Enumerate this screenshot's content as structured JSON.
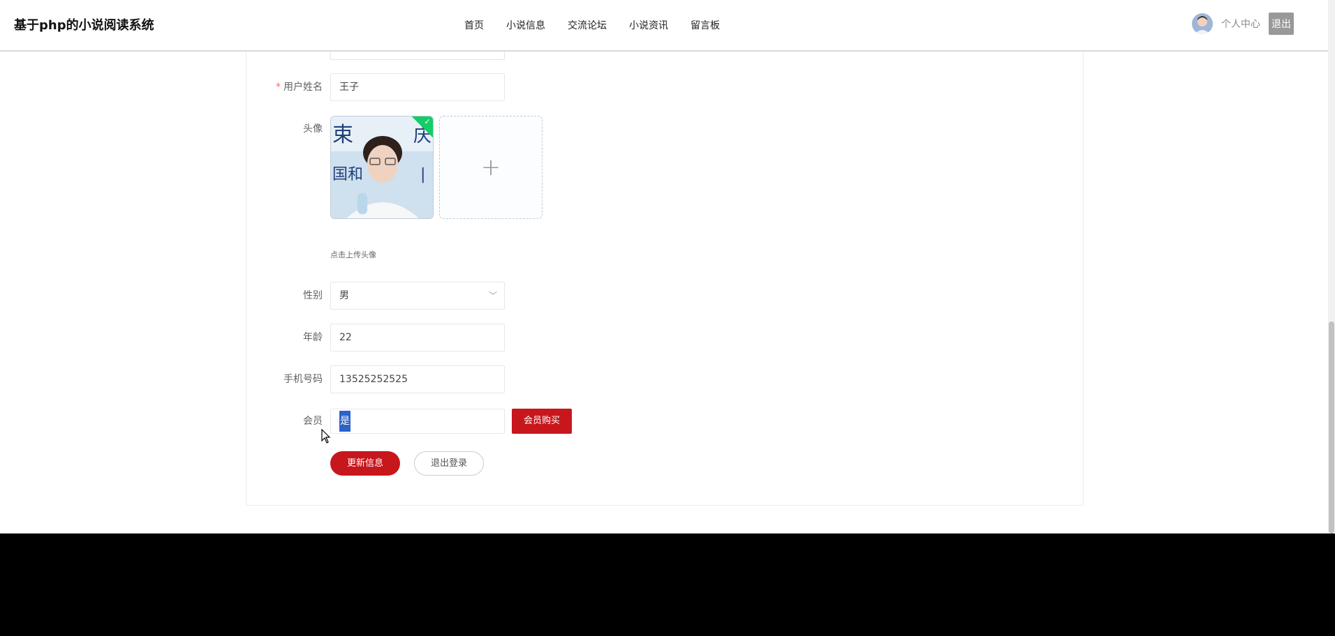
{
  "header": {
    "site_title": "基于php的小说阅读系统",
    "nav": [
      "首页",
      "小说信息",
      "交流论坛",
      "小说资讯",
      "留言板"
    ],
    "user_center": "个人中心",
    "logout": "退出"
  },
  "form": {
    "name_label": "用户姓名",
    "name_required_mark": "*",
    "name_value": "王子",
    "avatar_label": "头像",
    "avatar_hint": "点击上传头像",
    "gender_label": "性别",
    "gender_value": "男",
    "age_label": "年龄",
    "age_value": "22",
    "phone_label": "手机号码",
    "phone_value": "13525252525",
    "member_label": "会员",
    "member_value": "是",
    "buy_member": "会员购买",
    "update_button": "更新信息",
    "logout_button": "退出登录"
  },
  "icons": {
    "avatar_upload": "plus-icon",
    "uploaded_check": "check-icon",
    "gender_dropdown": "chevron-down-icon"
  },
  "colors": {
    "brand_red": "#c8161d",
    "success_green": "#13ce66",
    "selection_blue": "#2c63c9"
  }
}
